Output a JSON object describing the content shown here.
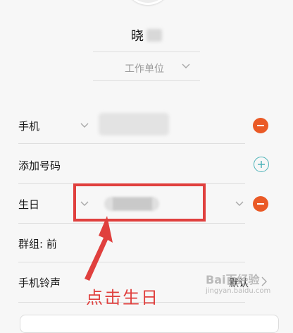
{
  "header": {
    "name_visible": "晓"
  },
  "company": {
    "placeholder": "工作单位"
  },
  "rows": {
    "phone": {
      "label": "手机"
    },
    "add_number": {
      "label": "添加号码"
    },
    "birthday": {
      "label": "生日"
    },
    "group": {
      "label": "群组: 前"
    },
    "ringtone": {
      "label": "手机铃声",
      "value": "默认"
    }
  },
  "annotation": {
    "text": "点击生日"
  },
  "watermark": {
    "main": "Bai百经验",
    "sub": "jingyan.baidu.com"
  },
  "colors": {
    "remove": "#ea5a26",
    "add": "#4db3b8",
    "annotation": "#e0403e"
  },
  "icons": {
    "chevron": "chevron-down-icon",
    "minus": "minus-circle-icon",
    "plus": "plus-circle-icon",
    "arrow": "chevron-right-icon"
  }
}
